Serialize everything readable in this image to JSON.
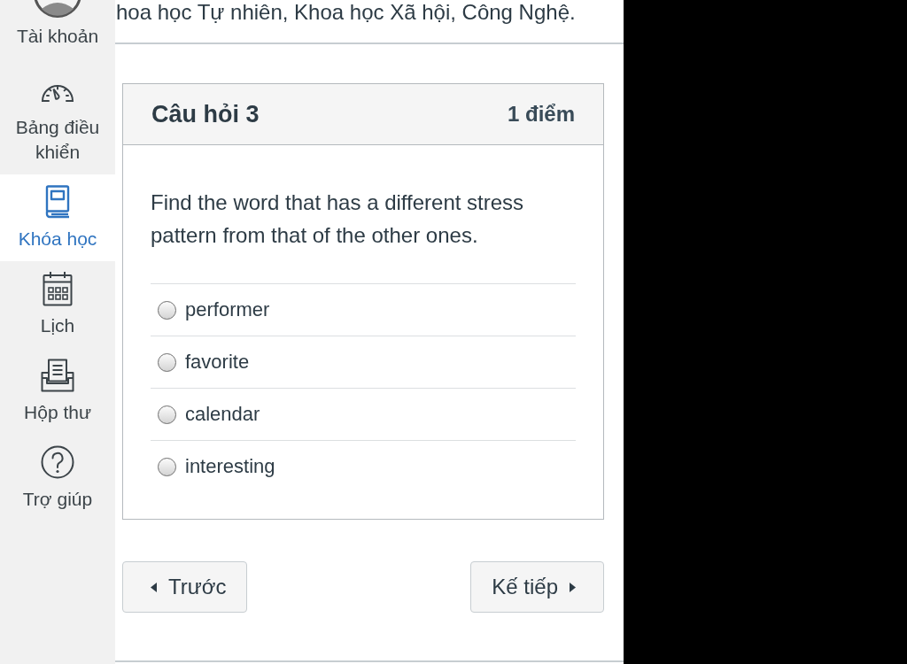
{
  "top_text": "hoa học Tự nhiên, Khoa học Xã hội, Công Nghệ.",
  "sidebar": {
    "items": [
      {
        "kind": "account",
        "label": "Tài khoản",
        "selected": false
      },
      {
        "kind": "dashboard",
        "label": "Bảng điều khiển",
        "selected": false
      },
      {
        "kind": "courses",
        "label": "Khóa học",
        "selected": true
      },
      {
        "kind": "calendar",
        "label": "Lịch",
        "selected": false
      },
      {
        "kind": "inbox",
        "label": "Hộp thư",
        "selected": false
      },
      {
        "kind": "help",
        "label": "Trợ giúp",
        "selected": false
      }
    ]
  },
  "question": {
    "title": "Câu hỏi 3",
    "points": "1 điểm",
    "text": "Find the word that has a different stress pattern from that of the other ones.",
    "answers": [
      {
        "label": "performer",
        "selected": false
      },
      {
        "label": "favorite",
        "selected": false
      },
      {
        "label": "calendar",
        "selected": false
      },
      {
        "label": "interesting",
        "selected": false
      }
    ]
  },
  "navigation": [
    {
      "kind": "previous",
      "label": "Trước"
    },
    {
      "kind": "next",
      "label": "Kế tiếp"
    }
  ]
}
